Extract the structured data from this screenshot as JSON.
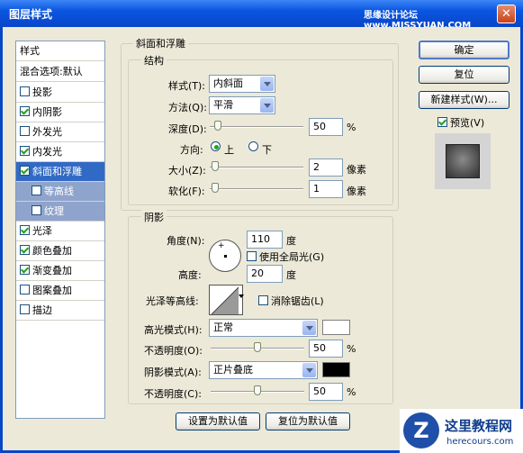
{
  "window": {
    "title": "图层样式",
    "watermark": "思缘设计论坛 www.MISSYUAN.COM"
  },
  "left_panel": {
    "header": "样式",
    "blend": "混合选项:默认",
    "items": [
      {
        "label": "投影",
        "checked": false
      },
      {
        "label": "内阴影",
        "checked": true
      },
      {
        "label": "外发光",
        "checked": false
      },
      {
        "label": "内发光",
        "checked": true
      },
      {
        "label": "斜面和浮雕",
        "checked": true,
        "selected": true
      },
      {
        "label": "等高线",
        "checked": false,
        "sub": true
      },
      {
        "label": "纹理",
        "checked": false,
        "sub": true
      },
      {
        "label": "光泽",
        "checked": true
      },
      {
        "label": "颜色叠加",
        "checked": true
      },
      {
        "label": "渐变叠加",
        "checked": true
      },
      {
        "label": "图案叠加",
        "checked": false
      },
      {
        "label": "描边",
        "checked": false
      }
    ]
  },
  "bevel": {
    "group_title": "斜面和浮雕",
    "structure_title": "结构",
    "style_label": "样式(T):",
    "style_value": "内斜面",
    "technique_label": "方法(Q):",
    "technique_value": "平滑",
    "depth_label": "深度(D):",
    "depth_value": "50",
    "depth_unit": "%",
    "depth_slider": 0.05,
    "direction_label": "方向:",
    "direction_up": "上",
    "direction_down": "下",
    "direction_selected": "up",
    "size_label": "大小(Z):",
    "size_value": "2",
    "size_unit": "像素",
    "size_slider": 0.02,
    "soften_label": "软化(F):",
    "soften_value": "1",
    "soften_unit": "像素",
    "soften_slider": 0.02
  },
  "shading": {
    "title": "阴影",
    "angle_label": "角度(N):",
    "angle_value": "110",
    "angle_unit": "度",
    "global_light_label": "使用全局光(G)",
    "global_light_checked": false,
    "altitude_label": "高度:",
    "altitude_value": "20",
    "altitude_unit": "度",
    "gloss_label": "光泽等高线:",
    "anti_alias_label": "消除锯齿(L)",
    "anti_alias_checked": false,
    "highlight_mode_label": "高光模式(H):",
    "highlight_mode_value": "正常",
    "highlight_color": "#ffffff",
    "highlight_opacity_label": "不透明度(O):",
    "highlight_opacity_value": "50",
    "highlight_opacity_slider": 0.5,
    "shadow_mode_label": "阴影模式(A):",
    "shadow_mode_value": "正片叠底",
    "shadow_color": "#000000",
    "shadow_opacity_label": "不透明度(C):",
    "shadow_opacity_value": "50",
    "shadow_opacity_slider": 0.5,
    "opacity_unit": "%"
  },
  "buttons": {
    "ok": "确定",
    "reset": "复位",
    "new_style": "新建样式(W)...",
    "preview_label": "预览(V)",
    "preview_checked": true,
    "set_default": "设置为默认值",
    "reset_default": "复位为默认值"
  },
  "logo": {
    "name": "这里教程网",
    "url": "herecours.com"
  }
}
